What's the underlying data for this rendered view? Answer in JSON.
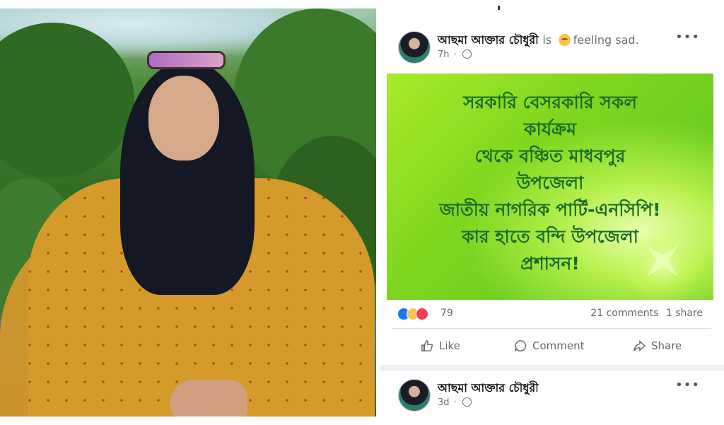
{
  "post1": {
    "author": "আছমা আক্তার চৌধুরী",
    "is_text": "is",
    "feeling_text": "feeling sad.",
    "time": "7h",
    "more": "•••",
    "banner_lines": [
      "সরকারি বেসরকারি সকল",
      "কার্যক্রম",
      "থেকে বঞ্চিত মাধবপুর",
      "উপজেলা",
      "জাতীয় নাগরিক পার্টি-এনসিপি!",
      "কার হাতে বন্দি উপজেলা",
      "প্রশাসন!"
    ],
    "reaction_count": "79",
    "comments": "21 comments",
    "shares": "1 share",
    "like_label": "Like",
    "comment_label": "Comment",
    "share_label": "Share"
  },
  "post2": {
    "author": "আছমা আক্তার চৌধুরী",
    "time": "3d",
    "more": "•••"
  },
  "icons": [
    "globe-icon",
    "like-icon",
    "comment-icon",
    "share-icon",
    "sad-emoji-icon",
    "more-options-icon"
  ],
  "colors": {
    "accent": "#1877f2",
    "banner_text": "#1a6b2a",
    "banner_bg": "#7fd61e"
  }
}
